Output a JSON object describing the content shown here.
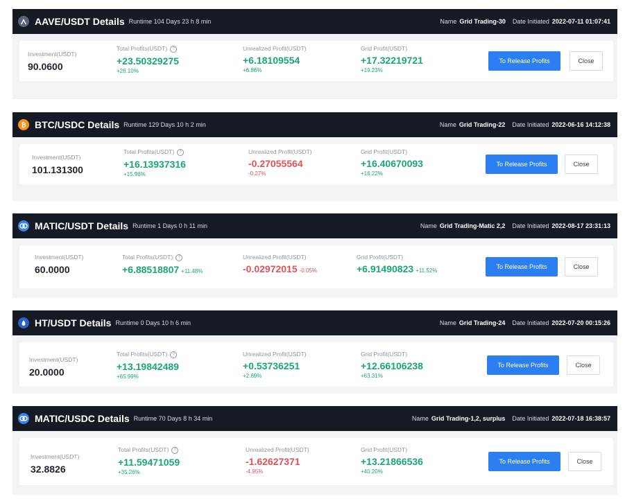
{
  "panels": [
    {
      "title": "AAVE/USDT Details",
      "runtime": "Runtime 104 Days 23 h 8 min",
      "name_label": "Name",
      "name_value": "Grid Trading-30",
      "date_label": "Date Initiated",
      "date_value": "2022-07-11 01:07:41",
      "investment_label": "Investment(USDT)",
      "investment_value": "90.0600",
      "total_label": "Total Profits(USDT)",
      "total_value": "+23.50329275",
      "total_pct": "+26.10%",
      "unrealized_label": "Unrealized Profit(USDT)",
      "unrealized_value": "+6.18109554",
      "unrealized_pct": "+6.86%",
      "grid_label": "Grid Profit(USDT)",
      "grid_value": "+17.32219721",
      "grid_pct": "+19.23%",
      "release_label": "To Release Profits",
      "close_label": "Close"
    },
    {
      "title": "BTC/USDC Details",
      "runtime": "Runtime 129 Days 10 h 2 min",
      "name_label": "Name",
      "name_value": "Grid Trading-22",
      "date_label": "Date Initiated",
      "date_value": "2022-06-16 14:12:38",
      "investment_label": "Investment(USDT)",
      "investment_value": "101.131300",
      "total_label": "Total Profits(USDT)",
      "total_value": "+16.13937316",
      "total_pct": "+15.96%",
      "unrealized_label": "Unrealized Profit(USDT)",
      "unrealized_value": "-0.27055564",
      "unrealized_pct": "-0.27%",
      "grid_label": "Grid Profit(USDT)",
      "grid_value": "+16.40670093",
      "grid_pct": "+16.22%",
      "release_label": "To Release Profits",
      "close_label": "Close"
    },
    {
      "title": "MATIC/USDT Details",
      "runtime": "Runtime 1 Days 0 h 11 min",
      "name_label": "Name",
      "name_value": "Grid Trading-Matic 2,2",
      "date_label": "Date Initiated",
      "date_value": "2022-08-17 23:31:13",
      "investment_label": "Investment(USDT)",
      "investment_value": "60.0000",
      "total_label": "Total Profits(USDT)",
      "total_value": "+6.88518807",
      "total_pct": "+11.48%",
      "unrealized_label": "Unrealized Profit(USDT)",
      "unrealized_value": "-0.02972015",
      "unrealized_pct": "-0.05%",
      "grid_label": "Grid Profit(USDT)",
      "grid_value": "+6.91490823",
      "grid_pct": "+11.52%",
      "release_label": "To Release Profits",
      "close_label": "Close"
    },
    {
      "title": "HT/USDT Details",
      "runtime": "Runtime 0 Days 10 h 6 min",
      "name_label": "Name",
      "name_value": "Grid Trading-24",
      "date_label": "Date Initiated",
      "date_value": "2022-07-20 00:15:26",
      "investment_label": "Investment(USDT)",
      "investment_value": "20.0000",
      "total_label": "Total Profits(USDT)",
      "total_value": "+13.19842489",
      "total_pct": "+65.99%",
      "unrealized_label": "Unrealized Profit(USDT)",
      "unrealized_value": "+0.53736251",
      "unrealized_pct": "+2.69%",
      "grid_label": "Grid Profit(USDT)",
      "grid_value": "+12.66106238",
      "grid_pct": "+63.31%",
      "release_label": "To Release Profits",
      "close_label": "Close"
    },
    {
      "title": "MATIC/USDC Details",
      "runtime": "Runtime 70 Days 8 h 34 min",
      "name_label": "Name",
      "name_value": "Grid Trading-1,2, surplus",
      "date_label": "Date Initiated",
      "date_value": "2022-07-18 16:38:57",
      "investment_label": "Investment(USDT)",
      "investment_value": "32.8826",
      "total_label": "Total Profits(USDT)",
      "total_value": "+11.59471059",
      "total_pct": "+35.26%",
      "unrealized_label": "Unrealized Profit(USDT)",
      "unrealized_value": "-1.62627371",
      "unrealized_pct": "-4.95%",
      "grid_label": "Grid Profit(USDT)",
      "grid_value": "+13.21866536",
      "grid_pct": "+40.20%",
      "release_label": "To Release Profits",
      "close_label": "Close"
    }
  ],
  "icons": [
    "aave-coin-icon",
    "btc-coin-icon",
    "matic-coin-icon",
    "ht-coin-icon",
    "matic-coin-icon"
  ],
  "colors": {
    "header_bg": "#161a24",
    "body_bg": "#f2f3f5",
    "positive": "#19a57a",
    "negative": "#e2505a",
    "accent_button": "#2b7ff0"
  }
}
